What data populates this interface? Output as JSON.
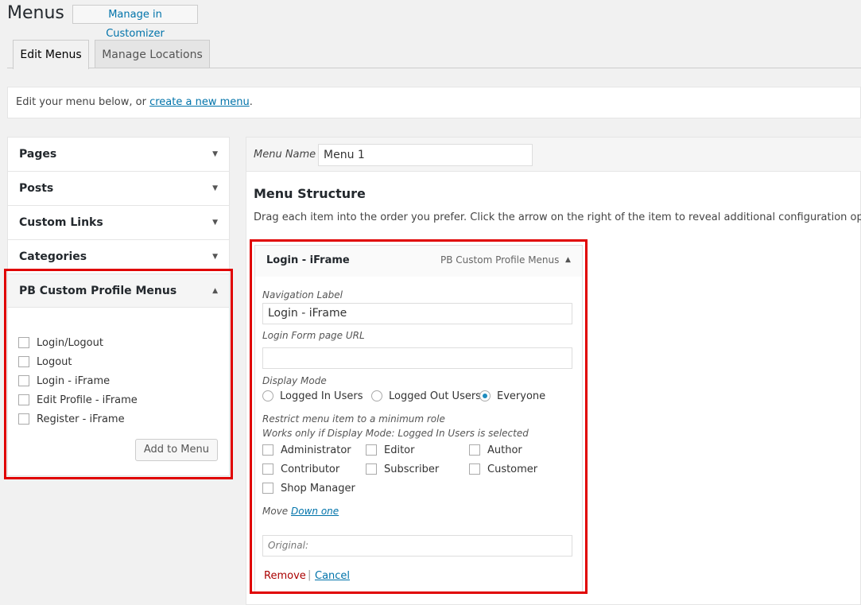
{
  "header": {
    "title": "Menus",
    "customizer_button": "Manage in Customizer"
  },
  "tabs": [
    {
      "label": "Edit Menus",
      "active": true
    },
    {
      "label": "Manage Locations",
      "active": false
    }
  ],
  "notice": {
    "prefix": "Edit your menu below, or ",
    "link": "create a new menu",
    "suffix": "."
  },
  "accordion": {
    "sections": [
      {
        "label": "Pages",
        "arrow": "▼"
      },
      {
        "label": "Posts",
        "arrow": "▼"
      },
      {
        "label": "Custom Links",
        "arrow": "▼"
      },
      {
        "label": "Categories",
        "arrow": "▼"
      },
      {
        "label": "PB Custom Profile Menus",
        "arrow": "▲"
      }
    ],
    "open_items": [
      "Login/Logout",
      "Logout",
      "Login - iFrame",
      "Edit Profile - iFrame",
      "Register - iFrame"
    ],
    "add_button": "Add to Menu"
  },
  "menu_editor": {
    "name_label": "Menu Name",
    "name_value": "Menu 1",
    "structure_title": "Menu Structure",
    "structure_desc": "Drag each item into the order you prefer. Click the arrow on the right of the item to reveal additional configuration options.",
    "item": {
      "title": "Login - iFrame",
      "type": "PB Custom Profile Menus",
      "arrow": "▲",
      "nav_label_caption": "Navigation Label",
      "nav_label_value": "Login - iFrame",
      "login_url_caption": "Login Form page URL",
      "login_url_value": "",
      "display_mode_caption": "Display Mode",
      "display_modes": [
        {
          "label": "Logged In Users",
          "checked": false
        },
        {
          "label": "Logged Out Users",
          "checked": false
        },
        {
          "label": "Everyone",
          "checked": true
        }
      ],
      "restrict_line1": "Restrict menu item to a minimum role",
      "restrict_line2": "Works only if Display Mode: Logged In Users is selected",
      "roles": [
        "Administrator",
        "Editor",
        "Author",
        "Contributor",
        "Subscriber",
        "Customer",
        "Shop Manager"
      ],
      "move_label": "Move",
      "move_link": "Down one",
      "original_label": "Original:",
      "remove": "Remove",
      "separator": "|",
      "cancel": "Cancel"
    }
  },
  "colors": {
    "highlight": "#e00000",
    "link": "#0073aa",
    "remove": "#a00000"
  }
}
